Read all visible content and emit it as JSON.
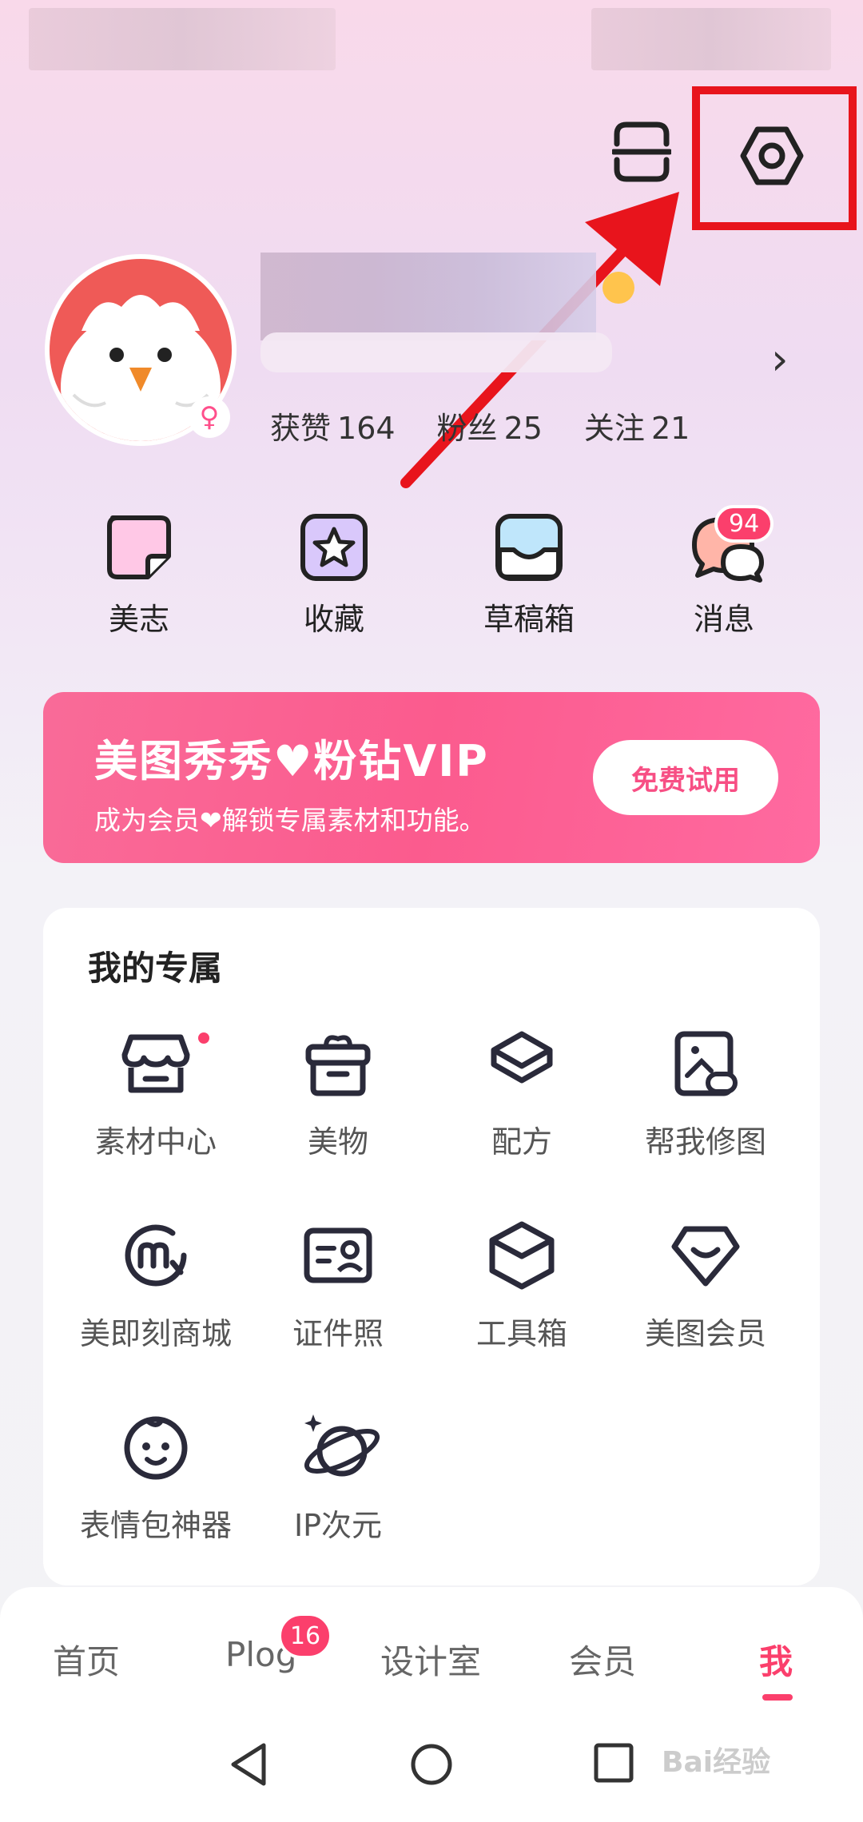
{
  "profile": {
    "stats": [
      {
        "label": "获赞",
        "value": "164"
      },
      {
        "label": "粉丝",
        "value": "25"
      },
      {
        "label": "关注",
        "value": "21"
      }
    ]
  },
  "shortcuts": [
    {
      "label": "美志",
      "icon": "note-icon"
    },
    {
      "label": "收藏",
      "icon": "star-icon"
    },
    {
      "label": "草稿箱",
      "icon": "drafts-icon"
    },
    {
      "label": "消息",
      "icon": "message-icon",
      "badge": "94"
    }
  ],
  "vip": {
    "title": "美图秀秀♥粉钻VIP",
    "subtitle": "成为会员❤解锁专属素材和功能。",
    "trial_label": "免费试用"
  },
  "exclusive": {
    "title": "我的专属",
    "items": [
      {
        "label": "素材中心",
        "icon": "store-icon"
      },
      {
        "label": "美物",
        "icon": "gift-box-icon"
      },
      {
        "label": "配方",
        "icon": "layers-icon"
      },
      {
        "label": "帮我修图",
        "icon": "photo-edit-icon"
      },
      {
        "label": "美即刻商城",
        "icon": "mall-icon"
      },
      {
        "label": "证件照",
        "icon": "id-card-icon"
      },
      {
        "label": "工具箱",
        "icon": "toolbox-icon"
      },
      {
        "label": "美图会员",
        "icon": "diamond-icon"
      },
      {
        "label": "表情包神器",
        "icon": "baby-face-icon"
      },
      {
        "label": "IP次元",
        "icon": "planet-icon"
      }
    ]
  },
  "bottom_nav": {
    "tabs": [
      "首页",
      "Plog",
      "设计室",
      "会员",
      "我"
    ],
    "plog_badge": "16",
    "active": "我"
  },
  "watermark": "Bai经验",
  "colors": {
    "accent": "#fb3f6c",
    "highlight": "#e8141c",
    "vip_pink": "#fb5b8e"
  }
}
